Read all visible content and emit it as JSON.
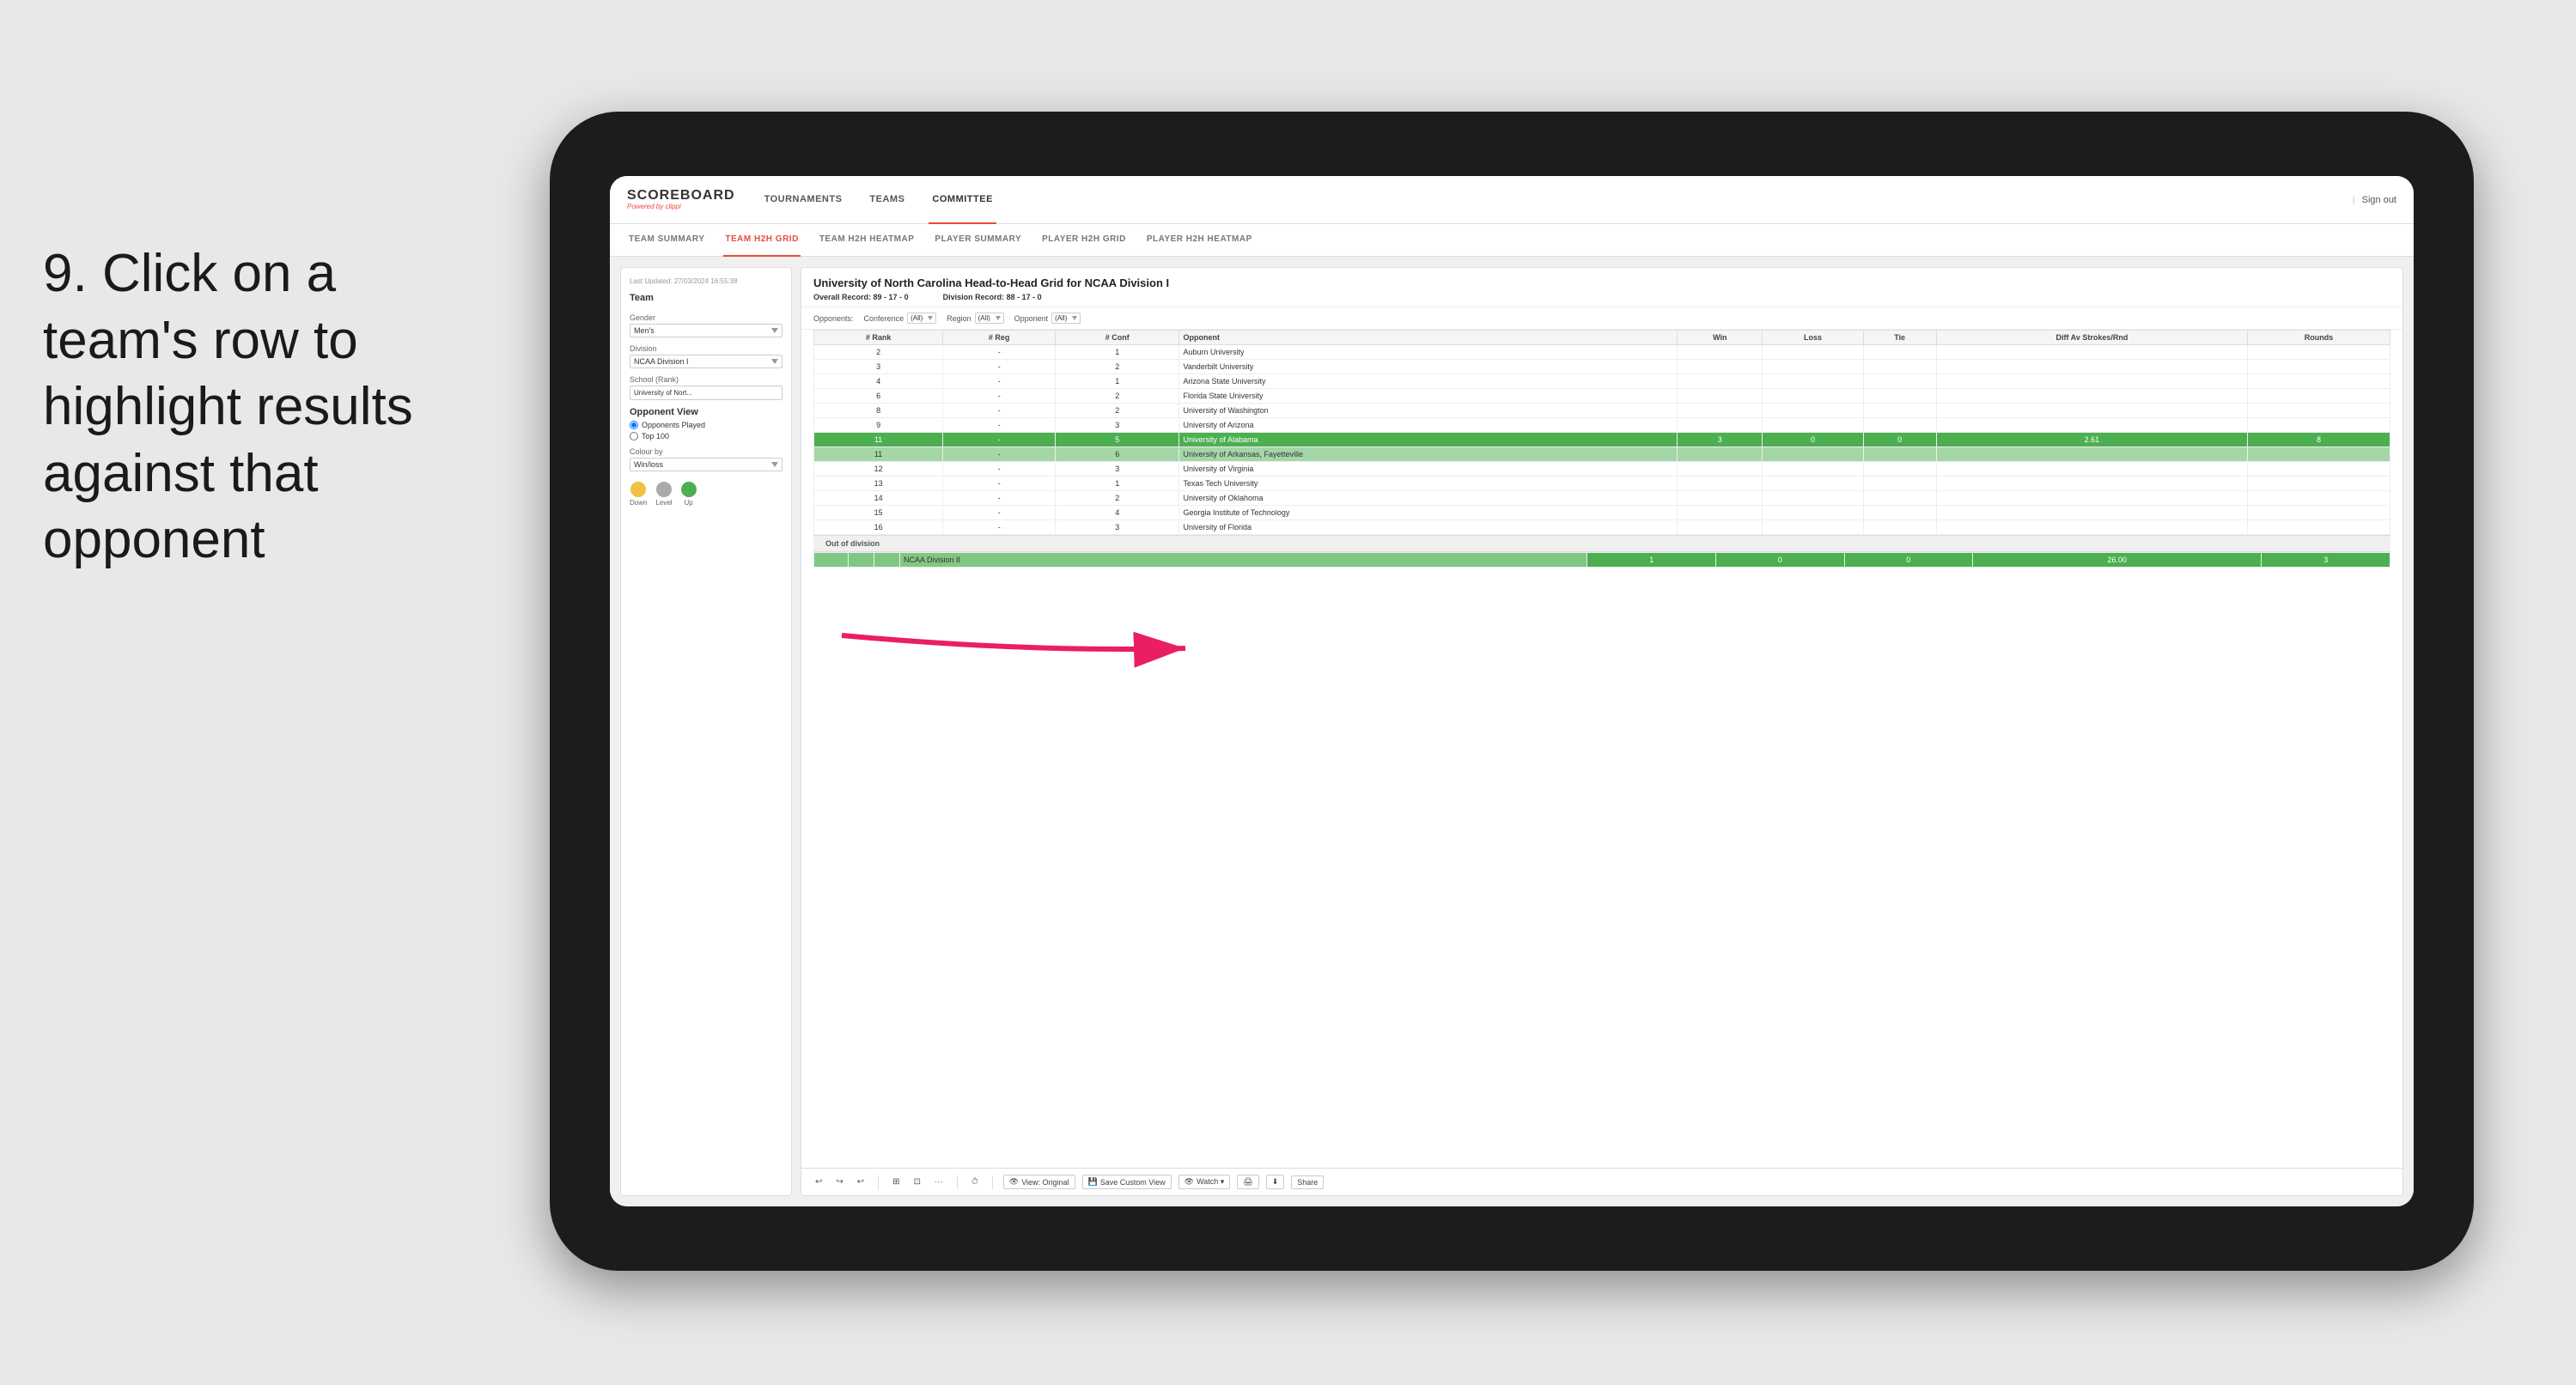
{
  "instruction": {
    "number": "9.",
    "text": "Click on a team's row to highlight results against that opponent"
  },
  "nav": {
    "logo": "SCOREBOARD",
    "logo_sub": "Powered by",
    "logo_brand": "clippi",
    "links": [
      {
        "label": "TOURNAMENTS",
        "active": false
      },
      {
        "label": "TEAMS",
        "active": false
      },
      {
        "label": "COMMITTEE",
        "active": true
      }
    ],
    "sign_out": "Sign out"
  },
  "sub_nav": {
    "links": [
      {
        "label": "TEAM SUMMARY",
        "active": false
      },
      {
        "label": "TEAM H2H GRID",
        "active": true
      },
      {
        "label": "TEAM H2H HEATMAP",
        "active": false
      },
      {
        "label": "PLAYER SUMMARY",
        "active": false
      },
      {
        "label": "PLAYER H2H GRID",
        "active": false
      },
      {
        "label": "PLAYER H2H HEATMAP",
        "active": false
      }
    ]
  },
  "sidebar": {
    "timestamp": "Last Updated: 27/03/2024\n16:55:38",
    "team_label": "Team",
    "gender_label": "Gender",
    "gender_value": "Men's",
    "division_label": "Division",
    "division_value": "NCAA Division I",
    "school_label": "School (Rank)",
    "school_value": "University of Nort...",
    "opponent_view_label": "Opponent View",
    "radio_opponents": "Opponents Played",
    "radio_top100": "Top 100",
    "colour_by_label": "Colour by",
    "colour_by_value": "Win/loss",
    "legend": {
      "down_label": "Down",
      "level_label": "Level",
      "up_label": "Up"
    }
  },
  "panel": {
    "title": "University of North Carolina Head-to-Head Grid for NCAA Division I",
    "overall_record_label": "Overall Record:",
    "overall_record": "89 - 17 - 0",
    "division_record_label": "Division Record:",
    "division_record": "88 - 17 - 0",
    "filters": {
      "opponents_label": "Opponents:",
      "conference_label": "Conference",
      "conference_value": "(All)",
      "region_label": "Region",
      "region_value": "(All)",
      "opponent_label": "Opponent",
      "opponent_value": "(All)"
    },
    "table": {
      "headers": [
        "# Rank",
        "# Reg",
        "# Conf",
        "Opponent",
        "Win",
        "Loss",
        "Tie",
        "Diff Av Strokes/Rnd",
        "Rounds"
      ],
      "rows": [
        {
          "rank": "2",
          "reg": "-",
          "conf": "1",
          "opponent": "Auburn University",
          "win": "",
          "loss": "",
          "tie": "",
          "diff": "",
          "rounds": "",
          "highlighted": false,
          "selected": false
        },
        {
          "rank": "3",
          "reg": "-",
          "conf": "2",
          "opponent": "Vanderbilt University",
          "win": "",
          "loss": "",
          "tie": "",
          "diff": "",
          "rounds": "",
          "highlighted": false,
          "selected": false
        },
        {
          "rank": "4",
          "reg": "-",
          "conf": "1",
          "opponent": "Arizona State University",
          "win": "",
          "loss": "",
          "tie": "",
          "diff": "",
          "rounds": "",
          "highlighted": false,
          "selected": false
        },
        {
          "rank": "6",
          "reg": "-",
          "conf": "2",
          "opponent": "Florida State University",
          "win": "",
          "loss": "",
          "tie": "",
          "diff": "",
          "rounds": "",
          "highlighted": false,
          "selected": false
        },
        {
          "rank": "8",
          "reg": "-",
          "conf": "2",
          "opponent": "University of Washington",
          "win": "",
          "loss": "",
          "tie": "",
          "diff": "",
          "rounds": "",
          "highlighted": false,
          "selected": false
        },
        {
          "rank": "9",
          "reg": "-",
          "conf": "3",
          "opponent": "University of Arizona",
          "win": "",
          "loss": "",
          "tie": "",
          "diff": "",
          "rounds": "",
          "highlighted": false,
          "selected": false
        },
        {
          "rank": "11",
          "reg": "-",
          "conf": "5",
          "opponent": "University of Alabama",
          "win": "3",
          "loss": "0",
          "tie": "0",
          "diff": "2.61",
          "rounds": "8",
          "highlighted": true,
          "selected": false
        },
        {
          "rank": "11",
          "reg": "-",
          "conf": "6",
          "opponent": "University of Arkansas, Fayetteville",
          "win": "",
          "loss": "",
          "tie": "",
          "diff": "",
          "rounds": "",
          "highlighted": false,
          "selected": true
        },
        {
          "rank": "12",
          "reg": "-",
          "conf": "3",
          "opponent": "University of Virginia",
          "win": "",
          "loss": "",
          "tie": "",
          "diff": "",
          "rounds": "",
          "highlighted": false,
          "selected": false
        },
        {
          "rank": "13",
          "reg": "-",
          "conf": "1",
          "opponent": "Texas Tech University",
          "win": "",
          "loss": "",
          "tie": "",
          "diff": "",
          "rounds": "",
          "highlighted": false,
          "selected": false
        },
        {
          "rank": "14",
          "reg": "-",
          "conf": "2",
          "opponent": "University of Oklahoma",
          "win": "",
          "loss": "",
          "tie": "",
          "diff": "",
          "rounds": "",
          "highlighted": false,
          "selected": false
        },
        {
          "rank": "15",
          "reg": "-",
          "conf": "4",
          "opponent": "Georgia Institute of Technology",
          "win": "",
          "loss": "",
          "tie": "",
          "diff": "",
          "rounds": "",
          "highlighted": false,
          "selected": false
        },
        {
          "rank": "16",
          "reg": "-",
          "conf": "3",
          "opponent": "University of Florida",
          "win": "",
          "loss": "",
          "tie": "",
          "diff": "",
          "rounds": "",
          "highlighted": false,
          "selected": false
        }
      ],
      "out_of_division_label": "Out of division",
      "out_of_division_row": {
        "name": "NCAA Division II",
        "win": "1",
        "loss": "0",
        "tie": "0",
        "diff": "26.00",
        "rounds": "3"
      }
    }
  },
  "toolbar": {
    "view_label": "View: Original",
    "save_label": "Save Custom View",
    "watch_label": "Watch ▾",
    "share_label": "Share"
  }
}
